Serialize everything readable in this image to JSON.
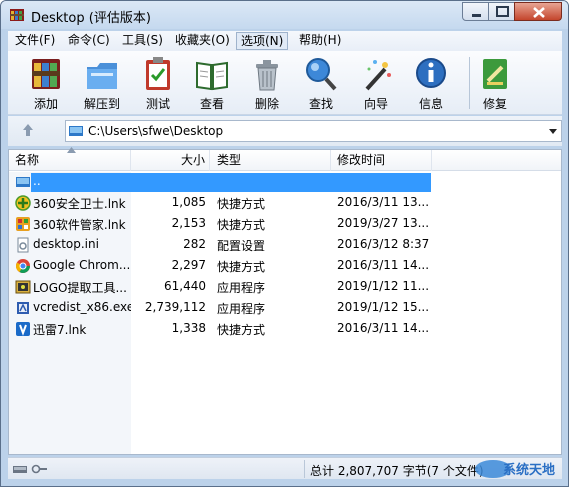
{
  "window": {
    "title": "Desktop (评估版本)"
  },
  "menu": [
    {
      "label": "文件(F)"
    },
    {
      "label": "命令(C)"
    },
    {
      "label": "工具(S)"
    },
    {
      "label": "收藏夹(O)"
    },
    {
      "label": "选项(N)"
    },
    {
      "label": "帮助(H)"
    }
  ],
  "toolbar": {
    "add": "添加",
    "extract": "解压到",
    "test": "测试",
    "view": "查看",
    "delete": "删除",
    "find": "查找",
    "wizard": "向导",
    "info": "信息",
    "repair": "修复"
  },
  "address": {
    "path": "C:\\Users\\sfwe\\Desktop"
  },
  "columns": {
    "name": "名称",
    "size": "大小",
    "type": "类型",
    "modified": "修改时间"
  },
  "files": [
    {
      "name": "..",
      "size": "",
      "type": "",
      "modified": "",
      "icon": "drive-up-icon"
    },
    {
      "name": "360安全卫士.lnk",
      "size": "1,085",
      "type": "快捷方式",
      "modified": "2016/3/11 13...",
      "icon": "360-security-icon"
    },
    {
      "name": "360软件管家.lnk",
      "size": "2,153",
      "type": "快捷方式",
      "modified": "2019/3/27 13...",
      "icon": "360-software-icon"
    },
    {
      "name": "desktop.ini",
      "size": "282",
      "type": "配置设置",
      "modified": "2016/3/12 8:37",
      "icon": "settings-file-icon"
    },
    {
      "name": "Google Chrom...",
      "size": "2,297",
      "type": "快捷方式",
      "modified": "2016/3/11 14...",
      "icon": "chrome-icon"
    },
    {
      "name": "LOGO提取工具...",
      "size": "61,440",
      "type": "应用程序",
      "modified": "2019/1/12 11...",
      "icon": "logo-tool-icon"
    },
    {
      "name": "vcredist_x86.exe",
      "size": "2,739,112",
      "type": "应用程序",
      "modified": "2019/1/12 15...",
      "icon": "installer-icon"
    },
    {
      "name": "迅雷7.lnk",
      "size": "1,338",
      "type": "快捷方式",
      "modified": "2016/3/11 14...",
      "icon": "thunder-icon"
    }
  ],
  "status": {
    "total": "总计 2,807,707 字节(7 个文件)"
  },
  "watermark": "系统天地"
}
